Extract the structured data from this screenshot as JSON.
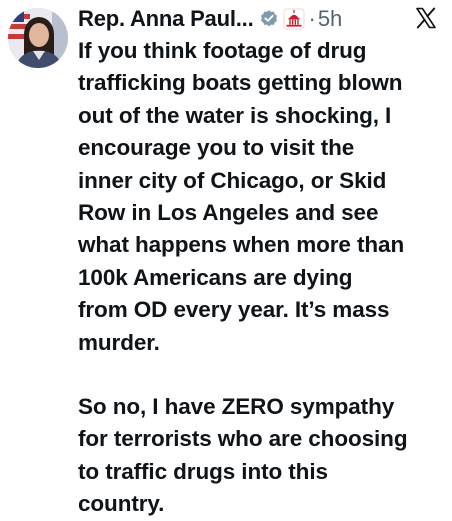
{
  "post": {
    "display_name": "Rep. Anna Paul...",
    "dot": "·",
    "timestamp": "5h",
    "icons": {
      "avatar": "profile-photo",
      "verified": "verified-badge-icon",
      "affiliation": "capitol-building-icon",
      "platform": "x-logo-icon"
    },
    "colors": {
      "text": "#0f1419",
      "muted": "#536471",
      "verified_badge": "#829aab",
      "affiliation_badge": "#c8202f"
    },
    "paragraphs": [
      [
        "If you think footage of drug",
        "trafficking boats getting blown",
        "out of the water is shocking, I",
        "encourage you to visit the",
        "inner city of Chicago, or Skid",
        "Row in Los Angeles and see",
        "what happens when more than",
        "100k Americans are dying",
        "from OD every year. It’s mass",
        "murder."
      ],
      [
        "So no, I have ZERO sympathy",
        "for terrorists who are choosing",
        "to traffic drugs into this",
        "country."
      ]
    ]
  }
}
